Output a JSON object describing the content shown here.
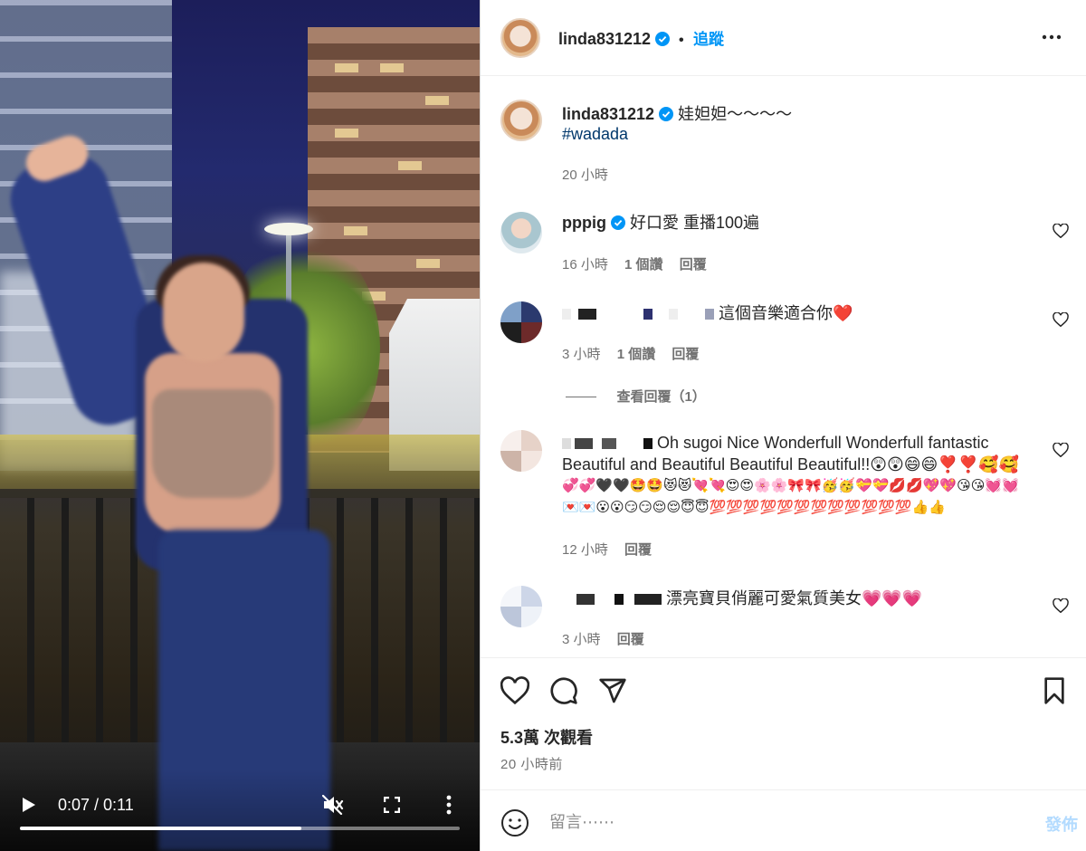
{
  "video": {
    "time": "0:07 / 0:11",
    "progress_fraction": 0.64
  },
  "post": {
    "username": "linda831212",
    "follow_label": "追蹤",
    "caption": "娃妲妲～～～～",
    "hashtag": "#wadada",
    "caption_time": "20 小時"
  },
  "comments": [
    {
      "username": "pppig",
      "text": "好口愛 重播100遍",
      "time": "16 小時",
      "likes": "1 個讚",
      "reply": "回覆"
    },
    {
      "username": "",
      "text": "這個音樂適合你❤️",
      "time": "3 小時",
      "likes": "1 個讚",
      "reply": "回覆",
      "view_replies": "查看回覆（1）"
    },
    {
      "username": "",
      "text": "Oh sugoi Nice Wonderfull Wonderfull fantastic",
      "text2": "Beautiful and Beautiful Beautiful Beautiful!!😲😲😄😄❣️❣️🥰🥰",
      "text3": "💞💞🖤🖤🤩🤩😻😻💘💘😍😍🌸🌸🎀🎀🥳🥳💝💝💋💋💖💖😘😘💓💓",
      "text4": "💌💌😮😮😏😏😌😌😇😇💯💯💯💯💯💯💯💯💯💯💯💯👍👍",
      "time": "12 小時",
      "reply": "回覆"
    },
    {
      "username": "",
      "text": "漂亮寶貝俏麗可愛氣質美女💗💗💗",
      "time": "3 小時",
      "reply": "回覆"
    }
  ],
  "stats": {
    "views": "5.3萬 次觀看",
    "posted": "20 小時前"
  },
  "composer": {
    "placeholder": "留言⋯⋯",
    "post_label": "發佈"
  },
  "colors": {
    "accent": "#0095f6",
    "post_disabled": "#b3dbff",
    "verified": "#0095f6"
  }
}
